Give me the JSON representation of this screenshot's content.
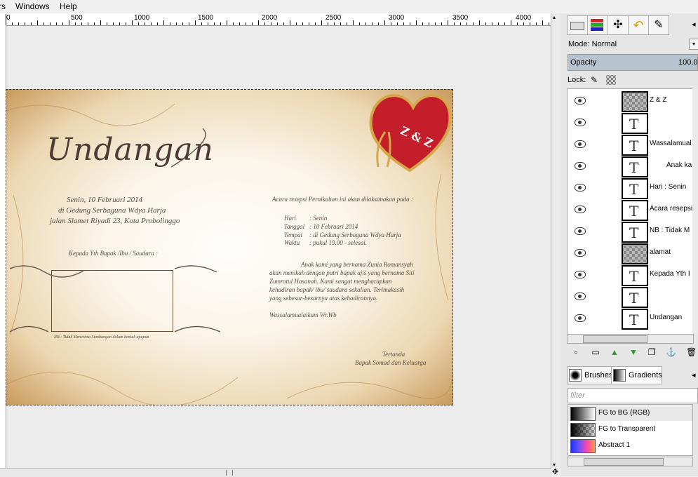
{
  "menubar": {
    "item_fragment": "rs",
    "windows": "Windows",
    "help": "Help"
  },
  "ruler": {
    "labels": [
      "0",
      "500",
      "1000",
      "1500",
      "2000",
      "2500",
      "3000",
      "3500",
      "4000"
    ]
  },
  "invitation": {
    "title": "Undangan",
    "date_line": "Senin, 10 Februari 2014",
    "venue_line": "di Gedung Serbaguna Wdya Harja",
    "street_line": "jalan Slamet Riyadi 23, Kota Probolinggo",
    "addressee": "Kepada Yth Bapak /Ibu / Saudara :",
    "nb_note": "NB : Tidak Menerima Sumbangan dalam bentuk apapun",
    "intro": "Acara resepsi Pernikahan ini akan dilaksanakan pada :",
    "details": [
      {
        "label": "Hari",
        "value": ": Senin"
      },
      {
        "label": "Tanggal",
        "value": ": 10 Februari 2014"
      },
      {
        "label": "Tempat",
        "value": ": di Gedung Serbaguna Wdya Harja"
      },
      {
        "label": "Waktu",
        "value": ": pukul 19.00 - selesai."
      }
    ],
    "paragraph": [
      "Anak kami yang bernama Zunia Romansyah",
      "akan menikah dengan putri bapak ajis yang bernama Siti",
      "Zumrotul Hasanah. Kami sangat mengharapkan",
      "kehadiran bapak/ ibu/ saudara sekalian. Terimakasih",
      "yang sebesar-besarnya atas kehadirannya."
    ],
    "closing": "Wassalamualaikum Wr.Wb",
    "signed": "Tertanda",
    "signature": "Bapak Somad dan Keluarga",
    "heart_text": "Z & Z"
  },
  "panel": {
    "mode_label": "Mode: Normal",
    "opacity_label": "Opacity",
    "opacity_value": "100.0",
    "lock_label": "Lock:",
    "layers": [
      {
        "name": "Z & Z",
        "thumb": "checker"
      },
      {
        "name": "",
        "thumb": "text"
      },
      {
        "name": "Wassalamual",
        "thumb": "text"
      },
      {
        "name": "Anak ka",
        "thumb": "text"
      },
      {
        "name": "Hari   : Senin",
        "thumb": "text"
      },
      {
        "name": "Acara resepsi",
        "thumb": "text"
      },
      {
        "name": "NB : Tidak M",
        "thumb": "text"
      },
      {
        "name": "alamat",
        "thumb": "checker"
      },
      {
        "name": "Kepada Yth I",
        "thumb": "text"
      },
      {
        "name": "",
        "thumb": "text"
      },
      {
        "name": "Undangan",
        "thumb": "text"
      }
    ],
    "tabs": {
      "brushes": "Brushes",
      "gradients": "Gradients"
    },
    "filter_placeholder": "filter",
    "gradients": [
      "FG to BG (RGB)",
      "FG to Transparent",
      "Abstract 1"
    ]
  },
  "colors": {
    "heart": "#c41e2a",
    "selection": "#b7c4d0",
    "ink": "#5a4a40"
  }
}
